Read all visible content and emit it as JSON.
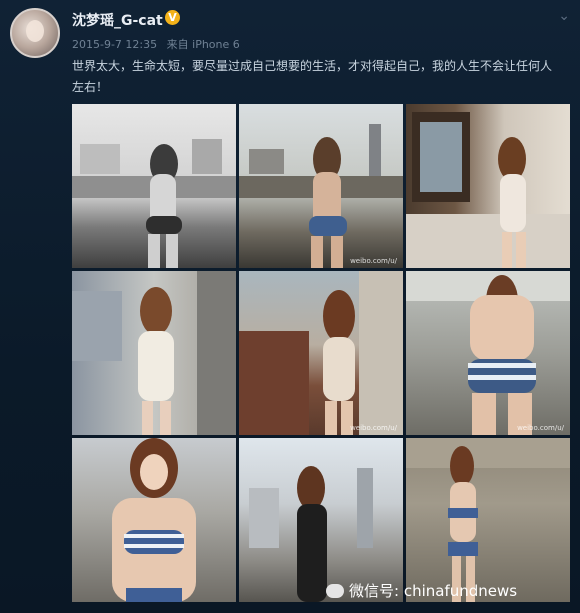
{
  "post": {
    "username": "沈梦瑶_G-cat",
    "verified_badge": "V",
    "date": "2015-9-7 12:35",
    "source": "来自 iPhone 6",
    "text": "世界太大，生命太短，要尽量过成自己想要的生活，才对得起自己，我的人生不会让任何人左右！"
  },
  "photos": [
    {
      "alt": "photo-1",
      "watermark": ""
    },
    {
      "alt": "photo-2",
      "watermark": "weibo.com/u/"
    },
    {
      "alt": "photo-3",
      "watermark": ""
    },
    {
      "alt": "photo-4",
      "watermark": ""
    },
    {
      "alt": "photo-5",
      "watermark": "weibo.com/u/"
    },
    {
      "alt": "photo-6",
      "watermark": "weibo.com/u/"
    },
    {
      "alt": "photo-7",
      "watermark": ""
    },
    {
      "alt": "photo-8",
      "watermark": ""
    },
    {
      "alt": "photo-9",
      "watermark": ""
    }
  ],
  "overlay": {
    "wechat_label": "微信号: chinafundnews"
  },
  "icons": {
    "corner": "chevron-down-icon"
  }
}
